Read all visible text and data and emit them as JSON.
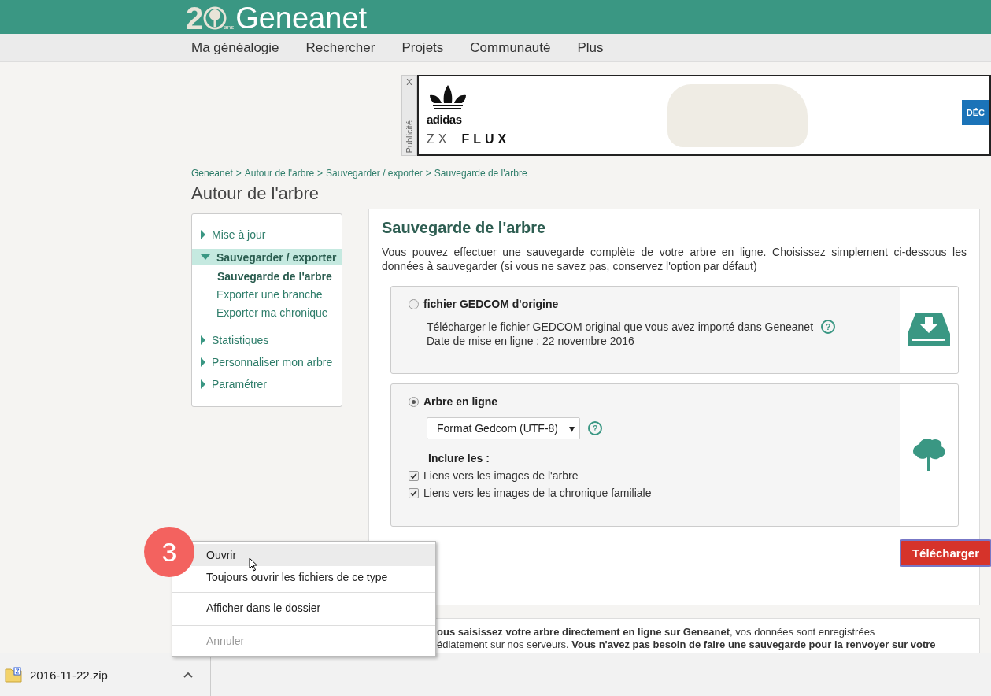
{
  "header": {
    "logo_number": "2",
    "logo_small": "ans",
    "logo_name": "Geneanet"
  },
  "nav": [
    "Ma généalogie",
    "Rechercher",
    "Projets",
    "Communauté",
    "Plus"
  ],
  "ad": {
    "label": "Publicité",
    "close": "X",
    "brand": "adidas",
    "product_prefix": "ZX",
    "product": "FLUX",
    "cta": "DÉC"
  },
  "breadcrumb": [
    "Geneanet",
    "Autour de l'arbre",
    "Sauvegarder / exporter",
    "Sauvegarde de l'arbre"
  ],
  "breadcrumb_separator": ">",
  "page_title": "Autour de l'arbre",
  "sidebar": {
    "items": [
      {
        "label": "Mise à jour",
        "expanded": false
      },
      {
        "label": "Sauvegarder / exporter",
        "expanded": true,
        "children": [
          {
            "label": "Sauvegarde de l'arbre",
            "selected": true
          },
          {
            "label": "Exporter une branche",
            "selected": false
          },
          {
            "label": "Exporter ma chronique",
            "selected": false
          }
        ]
      },
      {
        "label": "Statistiques",
        "expanded": false
      },
      {
        "label": "Personnaliser mon arbre",
        "expanded": false
      },
      {
        "label": "Paramétrer",
        "expanded": false
      }
    ]
  },
  "main": {
    "title": "Sauvegarde de l'arbre",
    "intro": "Vous pouvez effectuer une sauvegarde complète de votre arbre en ligne. Choisissez simplement ci-dessous les données à sauvegarder (si vous ne savez pas, conservez l'option par défaut)",
    "options": [
      {
        "kind": "file",
        "label": "fichier GEDCOM d'origine",
        "selected": false,
        "lines": [
          "Télécharger le fichier GEDCOM original que vous avez importé dans Geneanet",
          "Date de mise en ligne : 22 novembre 2016"
        ],
        "help": "?"
      },
      {
        "kind": "tree",
        "label": "Arbre en ligne",
        "selected": true,
        "format": "Format Gedcom (UTF-8)",
        "caret": "▾",
        "help": "?",
        "include_label": "Inclure les :",
        "checkboxes": [
          {
            "label": "Liens vers les images de l'arbre",
            "checked": true
          },
          {
            "label": "Liens vers les images de la chronique familiale",
            "checked": true
          }
        ]
      }
    ],
    "button": "Télécharger"
  },
  "info_card": {
    "lines": [
      "**ous saisissez votre arbre directement en ligne sur Geneanet**, vos données sont enregistrées",
      "édiatement sur nos serveurs. **Vous n'avez pas besoin de faire une sauvegarde pour la renvoyer sur votre**"
    ]
  },
  "context_menu": {
    "items": [
      {
        "label": "Ouvrir",
        "hovered": true,
        "disabled": false,
        "divider_above": false
      },
      {
        "label": "Toujours ouvrir les fichiers de ce type",
        "hovered": false,
        "disabled": false,
        "divider_above": false
      },
      {
        "label": "Afficher dans le dossier",
        "hovered": false,
        "disabled": false,
        "divider_above": true
      },
      {
        "label": "Annuler",
        "hovered": false,
        "disabled": true,
        "divider_above": true
      }
    ]
  },
  "step_badge": "3",
  "download_shelf": {
    "file": "2016-11-22.zip"
  }
}
